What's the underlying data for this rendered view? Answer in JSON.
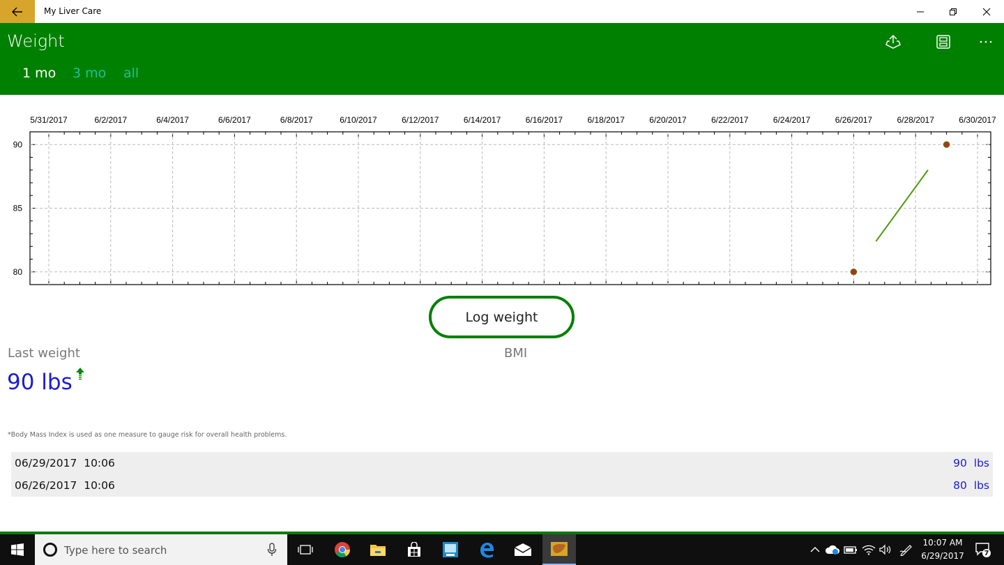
{
  "window": {
    "title": "My Liver Care"
  },
  "header": {
    "title": "Weight",
    "tabs": [
      {
        "label": "1 mo",
        "selected": true
      },
      {
        "label": "3 mo",
        "selected": false
      },
      {
        "label": "all",
        "selected": false
      }
    ],
    "icons": [
      "share-icon",
      "save-icon",
      "more-icon"
    ]
  },
  "chart_data": {
    "type": "line",
    "x_tick_labels": [
      "5/31/2017",
      "6/2/2017",
      "6/4/2017",
      "6/6/2017",
      "6/8/2017",
      "6/10/2017",
      "6/12/2017",
      "6/14/2017",
      "6/16/2017",
      "6/18/2017",
      "6/20/2017",
      "6/22/2017",
      "6/24/2017",
      "6/26/2017",
      "6/28/2017",
      "6/30/2017"
    ],
    "y_tick_labels": [
      "80",
      "85",
      "90"
    ],
    "ylim": [
      79,
      91
    ],
    "xlim": [
      "5/31/2017",
      "6/30/2017"
    ],
    "grid": true,
    "point_color": "#cc2222",
    "line_color": "#4a9a0a",
    "points": [
      {
        "x": "6/26/2017",
        "y": 80
      },
      {
        "x": "6/29/2017",
        "y": 90
      }
    ]
  },
  "log_button": {
    "label": "Log weight"
  },
  "last_weight": {
    "label": "Last weight",
    "value": "90 lbs",
    "trend": "up"
  },
  "bmi": {
    "label": "BMI"
  },
  "footnote": "*Body Mass Index is used as one measure to gauge risk for overall health problems.",
  "history": [
    {
      "date": "06/29/2017",
      "time": "10:06",
      "value": "90",
      "unit": "lbs"
    },
    {
      "date": "06/26/2017",
      "time": "10:06",
      "value": "80",
      "unit": "lbs"
    }
  ],
  "colors": {
    "header": "#008000",
    "tab_inactive": "#1fbf9f",
    "value_blue": "#1b1bd6",
    "back_button": "#d7a52c"
  },
  "taskbar": {
    "search_placeholder": "Type here to search",
    "apps": [
      "task-view-icon",
      "chrome-icon",
      "file-explorer-icon",
      "store-icon",
      "app-icon",
      "edge-icon",
      "mail-icon",
      "my-liver-care-icon"
    ],
    "clock_time": "10:07 AM",
    "clock_date": "6/29/2017",
    "notification_count": "7"
  }
}
